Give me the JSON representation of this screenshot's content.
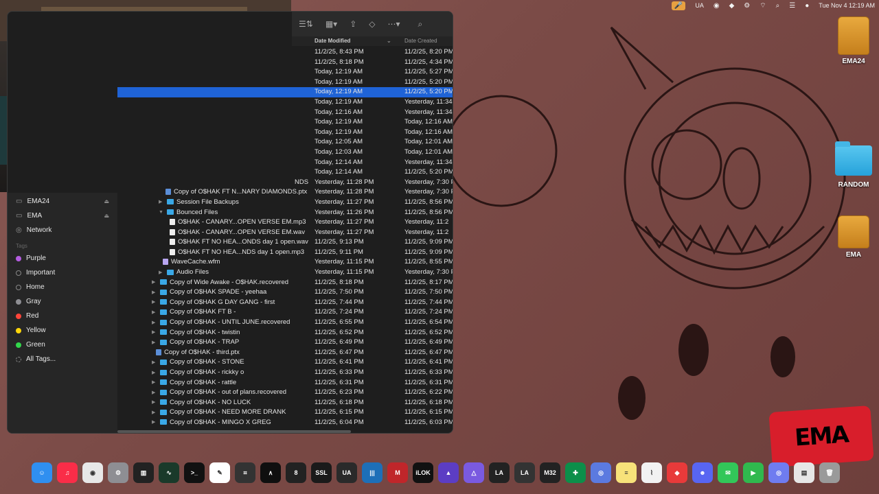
{
  "menubar": {
    "items": [
      "UA"
    ],
    "clock": "Tue Nov 4  12:19 AM"
  },
  "desktop": {
    "icons": [
      {
        "label": "EMA24",
        "kind": "drive"
      },
      {
        "label": "RANDOM",
        "kind": "folder"
      },
      {
        "label": "EMA",
        "kind": "drive"
      }
    ]
  },
  "finder": {
    "sidebar": {
      "locations": [
        {
          "label": "EMA24",
          "icon": "drive-icon",
          "eject": true
        },
        {
          "label": "EMA",
          "icon": "drive-icon",
          "eject": true
        },
        {
          "label": "Network",
          "icon": "network-icon",
          "eject": false
        }
      ],
      "tags_title": "Tags",
      "tags": [
        {
          "label": "Purple",
          "color": "#b45de0"
        },
        {
          "label": "Important",
          "color": ""
        },
        {
          "label": "Home",
          "color": ""
        },
        {
          "label": "Gray",
          "color": "#8e8e93"
        },
        {
          "label": "Red",
          "color": "#ff453a"
        },
        {
          "label": "Yellow",
          "color": "#ffd60a"
        },
        {
          "label": "Green",
          "color": "#32d74b"
        },
        {
          "label": "All Tags...",
          "color": ""
        }
      ]
    },
    "columns": {
      "modified": "Date Modified",
      "created": "Date Created"
    },
    "rows": [
      {
        "name": "",
        "mod": "11/2/25, 8:43 PM",
        "cre": "11/2/25, 8:20 PM"
      },
      {
        "name": "",
        "mod": "11/2/25, 8:18 PM",
        "cre": "11/2/25, 4:34 PM"
      },
      {
        "name": "",
        "mod": "Today, 12:19 AM",
        "cre": "11/2/25, 5:27 PM"
      },
      {
        "name": "",
        "mod": "Today, 12:19 AM",
        "cre": "11/2/25, 5:20 PM"
      },
      {
        "name": "",
        "mod": "Today, 12:19 AM",
        "cre": "11/2/25, 5:20 PM",
        "selected": true
      },
      {
        "name": "",
        "mod": "Today, 12:19 AM",
        "cre": "Yesterday, 11:34"
      },
      {
        "name": "",
        "mod": "Today, 12:16 AM",
        "cre": "Yesterday, 11:34"
      },
      {
        "name": "",
        "mod": "Today, 12:19 AM",
        "cre": "Today, 12:16 AM"
      },
      {
        "name": "",
        "mod": "Today, 12:19 AM",
        "cre": "Today, 12:16 AM"
      },
      {
        "name": "",
        "mod": "Today, 12:05 AM",
        "cre": "Today, 12:01 AM"
      },
      {
        "name": "",
        "mod": "Today, 12:03 AM",
        "cre": "Today, 12:01 AM"
      },
      {
        "name": "",
        "mod": "Today, 12:14 AM",
        "cre": "Yesterday, 11:34"
      },
      {
        "name": "",
        "mod": "Today, 12:14 AM",
        "cre": "11/2/25, 5:20 PM"
      },
      {
        "name": "NDS",
        "mod": "Yesterday, 11:28 PM",
        "cre": "Yesterday, 7:30 PM",
        "indent": 258,
        "kind": "none"
      },
      {
        "name": "Copy of O$HAK FT N...NARY DIAMONDS.ptx",
        "mod": "Yesterday, 11:28 PM",
        "cre": "Yesterday, 7:30 PM",
        "indent": 70,
        "kind": "ptx"
      },
      {
        "name": "Session File Backups",
        "mod": "Yesterday, 11:27 PM",
        "cre": "11/2/25, 8:56 PM",
        "indent": 60,
        "kind": "folder",
        "chevron": "▶"
      },
      {
        "name": "Bounced Files",
        "mod": "Yesterday, 11:26 PM",
        "cre": "11/2/25, 8:56 PM",
        "indent": 60,
        "kind": "folder",
        "chevron": "▼"
      },
      {
        "name": "O$HAK  - CANARY...OPEN VERSE EM.mp3",
        "mod": "Yesterday, 11:27 PM",
        "cre": "Yesterday, 11:2",
        "indent": 76,
        "kind": "file"
      },
      {
        "name": "O$HAK  - CANARY...OPEN VERSE EM.wav",
        "mod": "Yesterday, 11:27 PM",
        "cre": "Yesterday, 11:2",
        "indent": 76,
        "kind": "file"
      },
      {
        "name": "O$HAK FT NO HEA...ONDS day 1 open.wav",
        "mod": "11/2/25, 9:13 PM",
        "cre": "11/2/25, 9:09 PM",
        "indent": 76,
        "kind": "file"
      },
      {
        "name": "O$HAK FT NO HEA...NDS day 1 open.mp3",
        "mod": "11/2/25, 9:11 PM",
        "cre": "11/2/25, 9:09 PM",
        "indent": 76,
        "kind": "file"
      },
      {
        "name": "WaveCache.wfm",
        "mod": "Yesterday, 11:15 PM",
        "cre": "11/2/25, 8:55 PM",
        "indent": 66,
        "kind": "wave"
      },
      {
        "name": "Audio Files",
        "mod": "Yesterday, 11:15 PM",
        "cre": "Yesterday, 7:30 PM",
        "indent": 60,
        "kind": "folder",
        "chevron": "▶"
      },
      {
        "name": "Copy of Wide Awake - O$HAK.recovered",
        "mod": "11/2/25, 8:18 PM",
        "cre": "11/2/25, 8:17 PM",
        "indent": 50,
        "kind": "folder",
        "chevron": "▶"
      },
      {
        "name": "Copy of O$HAK SPADE - yeehaa",
        "mod": "11/2/25, 7:50 PM",
        "cre": "11/2/25, 7:50 PM",
        "indent": 50,
        "kind": "folder",
        "chevron": "▶"
      },
      {
        "name": "Copy of O$HAK G DAY GANG - first",
        "mod": "11/2/25, 7:44 PM",
        "cre": "11/2/25, 7:44 PM",
        "indent": 50,
        "kind": "folder",
        "chevron": "▶"
      },
      {
        "name": "Copy of O$HAK FT B -",
        "mod": "11/2/25, 7:24 PM",
        "cre": "11/2/25, 7:24 PM",
        "indent": 50,
        "kind": "folder",
        "chevron": "▶"
      },
      {
        "name": "Copy of O$HAK - UNTIL JUNE.recovered",
        "mod": "11/2/25, 6:55 PM",
        "cre": "11/2/25, 6:54 PM",
        "indent": 50,
        "kind": "folder",
        "chevron": "▶"
      },
      {
        "name": "Copy of O$HAK - twistin",
        "mod": "11/2/25, 6:52 PM",
        "cre": "11/2/25, 6:52 PM",
        "indent": 50,
        "kind": "folder",
        "chevron": "▶"
      },
      {
        "name": "Copy of O$HAK - TRAP",
        "mod": "11/2/25, 6:49 PM",
        "cre": "11/2/25, 6:49 PM",
        "indent": 50,
        "kind": "folder",
        "chevron": "▶"
      },
      {
        "name": "Copy of O$HAK - third.ptx",
        "mod": "11/2/25, 6:47 PM",
        "cre": "11/2/25, 6:47 PM",
        "indent": 56,
        "kind": "ptx"
      },
      {
        "name": "Copy of O$HAK - STONE",
        "mod": "11/2/25, 6:41 PM",
        "cre": "11/2/25, 6:41 PM",
        "indent": 50,
        "kind": "folder",
        "chevron": "▶"
      },
      {
        "name": "Copy of O$HAK - rickky o",
        "mod": "11/2/25, 6:33 PM",
        "cre": "11/2/25, 6:33 PM",
        "indent": 50,
        "kind": "folder",
        "chevron": "▶"
      },
      {
        "name": "Copy of O$HAK - rattle",
        "mod": "11/2/25, 6:31 PM",
        "cre": "11/2/25, 6:31 PM",
        "indent": 50,
        "kind": "folder",
        "chevron": "▶"
      },
      {
        "name": "Copy of O$HAK - out of plans.recovered",
        "mod": "11/2/25, 6:23 PM",
        "cre": "11/2/25, 6:22 PM",
        "indent": 50,
        "kind": "folder",
        "chevron": "▶"
      },
      {
        "name": "Copy of O$HAK - NO LUCK",
        "mod": "11/2/25, 6:18 PM",
        "cre": "11/2/25, 6:18 PM",
        "indent": 50,
        "kind": "folder",
        "chevron": "▶"
      },
      {
        "name": "Copy of O$HAK - NEED MORE DRANK",
        "mod": "11/2/25, 6:15 PM",
        "cre": "11/2/25, 6:15 PM",
        "indent": 50,
        "kind": "folder",
        "chevron": "▶"
      },
      {
        "name": "Copy of O$HAK - MINGO X GREG",
        "mod": "11/2/25, 6:04 PM",
        "cre": "11/2/25, 6:03 PM",
        "indent": 50,
        "kind": "folder",
        "chevron": "▶"
      }
    ]
  },
  "dock": {
    "apps": [
      {
        "name": "finder-app",
        "color": "#2f8ff0",
        "glyph": "☺"
      },
      {
        "name": "music-app",
        "color": "#fa2d48",
        "glyph": "♫"
      },
      {
        "name": "chrome-app",
        "color": "#e8e8e8",
        "glyph": "◉"
      },
      {
        "name": "system-settings-app",
        "color": "#8e8e93",
        "glyph": "⚙"
      },
      {
        "name": "piano-app",
        "color": "#222222",
        "glyph": "▥"
      },
      {
        "name": "waveform-app",
        "color": "#1a3a2a",
        "glyph": "∿"
      },
      {
        "name": "terminal-app",
        "color": "#111111",
        "glyph": ">_"
      },
      {
        "name": "pen-app",
        "color": "#ffffff",
        "glyph": "✎"
      },
      {
        "name": "crop-app",
        "color": "#333333",
        "glyph": "⌗"
      },
      {
        "name": "ableton-app",
        "color": "#0f0f0f",
        "glyph": "∧"
      },
      {
        "name": "num-app",
        "color": "#222222",
        "glyph": "8"
      },
      {
        "name": "ssl-app",
        "color": "#1a1a1a",
        "glyph": "SSL"
      },
      {
        "name": "ua-app",
        "color": "#2a2a2a",
        "glyph": "UA"
      },
      {
        "name": "meter-app",
        "color": "#1d6fb8",
        "glyph": "|||"
      },
      {
        "name": "m-app",
        "color": "#c0262a",
        "glyph": "M"
      },
      {
        "name": "ilok-app",
        "color": "#111111",
        "glyph": "iLOK"
      },
      {
        "name": "arturia-app",
        "color": "#5c3dc4",
        "glyph": "▲"
      },
      {
        "name": "analog-lab-app",
        "color": "#7a5ae0",
        "glyph": "△"
      },
      {
        "name": "la-app",
        "color": "#222222",
        "glyph": "LA"
      },
      {
        "name": "la2-app",
        "color": "#333333",
        "glyph": "LA"
      },
      {
        "name": "m32-edit-app",
        "color": "#222222",
        "glyph": "M32"
      },
      {
        "name": "plugin-app",
        "color": "#0c8f4a",
        "glyph": "✚"
      },
      {
        "name": "screen-app",
        "color": "#5b7ae0",
        "glyph": "◎"
      },
      {
        "name": "notes-app",
        "color": "#f7e27a",
        "glyph": "≡"
      },
      {
        "name": "activity-app",
        "color": "#f2f2f2",
        "glyph": "⌇"
      },
      {
        "name": "anydesk-app",
        "color": "#e83a3a",
        "glyph": "◆"
      },
      {
        "name": "discord-app",
        "color": "#5865f2",
        "glyph": "☻"
      },
      {
        "name": "messages-app",
        "color": "#32c759",
        "glyph": "✉"
      },
      {
        "name": "facetime-app",
        "color": "#30b94e",
        "glyph": "▶"
      },
      {
        "name": "screenshot-app",
        "color": "#6f7cf0",
        "glyph": "◎"
      },
      {
        "name": "preview-app",
        "color": "#e6e6e6",
        "glyph": "▤"
      },
      {
        "name": "trash-app",
        "color": "#9a9a9a",
        "glyph": "🗑"
      }
    ]
  }
}
